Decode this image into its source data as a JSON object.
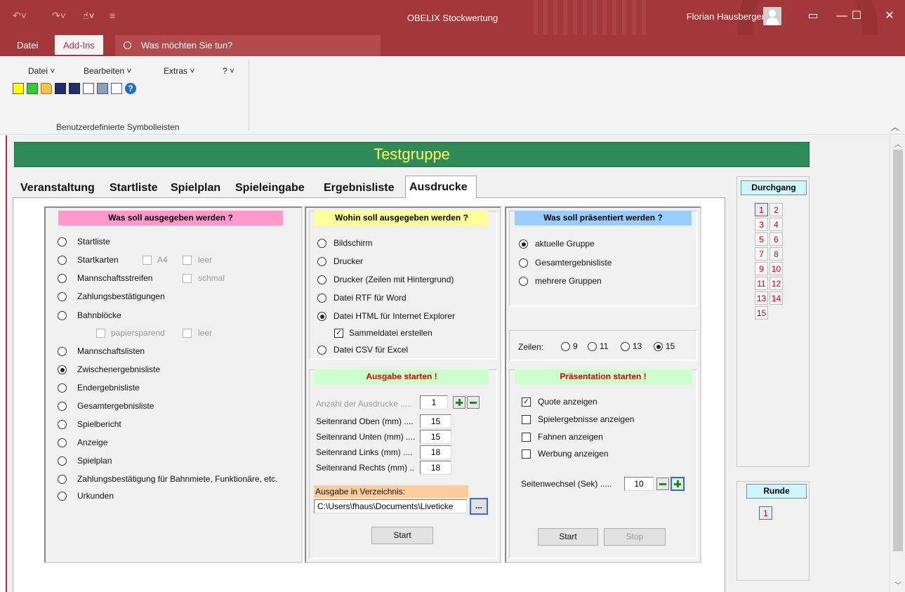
{
  "titlebar": {
    "title": "OBELIX Stockwertung",
    "user": "Florian Hausberger"
  },
  "ribbon_tabs": {
    "datei": "Datei",
    "addins": "Add-Ins",
    "tellme": "Was möchten Sie tun?"
  },
  "ribbon": {
    "menus": [
      "Datei ˅",
      "Bearbeiten ˅",
      "Extras ˅",
      "? ˅"
    ],
    "group_label": "Benutzerdefinierte Symbolleisten"
  },
  "group_title": "Testgruppe",
  "tabs": [
    "Veranstaltung",
    "Startliste",
    "Spielplan",
    "Spieleingabe",
    "Ergebnisliste",
    "Ausdrucke"
  ],
  "colors": {
    "title_bar": "#a4373a",
    "group_bar": "#2e8b57",
    "group_text": "#ffff66"
  },
  "left_panel": {
    "header": "Was soll ausgegeben werden ?",
    "options": [
      "Startliste",
      "Startkarten",
      "Mannschaftsstreifen",
      "Zahlungsbestätigungen",
      "Bahnblöcke",
      "Mannschaftslisten",
      "Zwischenergebnisliste",
      "Endergebnisliste",
      "Gesamtergebnisliste",
      "Spielbericht",
      "Anzeige",
      "Spielplan",
      "Zahlungsbestätigung für Bahnmiete, Funktionäre, etc.",
      "Urkunden"
    ],
    "sub_a4": "A4",
    "sub_leer": "leer",
    "sub_schmal": "schmal",
    "sub_papiersparend": "papiersparend",
    "sub_leer2": "leer"
  },
  "mid_panel": {
    "header": "Wohin soll ausgegeben werden ?",
    "options": [
      "Bildschirm",
      "Drucker",
      "Drucker (Zeilen mit Hintergrund)",
      "Datei RTF für Word",
      "Datei HTML für Internet Explorer",
      "Datei CSV für Excel"
    ],
    "sammeldatei": "Sammeldatei erstellen",
    "start_header": "Ausgabe starten !",
    "anzahl_label": "Anzahl der Ausdrucke .....",
    "anzahl_value": "1",
    "margins": [
      {
        "label": "Seitenrand Oben  (mm) ....",
        "value": "15"
      },
      {
        "label": "Seitenrand Unten (mm) ....",
        "value": "15"
      },
      {
        "label": "Seitenrand Links (mm) ....",
        "value": "18"
      },
      {
        "label": "Seitenrand Rechts (mm) ..",
        "value": "18"
      }
    ],
    "dir_label": "Ausgabe in Verzeichnis:",
    "dir_value": "C:\\Users\\fhaus\\Documents\\Liveticke",
    "browse": "...",
    "start": "Start"
  },
  "right_panel": {
    "header": "Was soll präsentiert werden ?",
    "options": [
      "aktuelle Gruppe",
      "Gesamtergebnisliste",
      "mehrere Gruppen"
    ],
    "zeilen_label": "Zeilen:",
    "zeilen_options": [
      "9",
      "11",
      "13",
      "15"
    ],
    "pres_header": "Präsentation starten !",
    "checks": [
      "Quote anzeigen",
      "Spielergebnisse anzeigen",
      "Fahnen anzeigen",
      "Werbung anzeigen"
    ],
    "wechsel_label": "Seitenwechsel (Sek) .....",
    "wechsel_value": "10",
    "start": "Start",
    "stop": "Stop"
  },
  "durchgang": {
    "header": "Durchgang",
    "numbers": [
      "1",
      "2",
      "3",
      "4",
      "5",
      "6",
      "7",
      "8",
      "9",
      "10",
      "11",
      "12",
      "13",
      "14",
      "15"
    ]
  },
  "runde": {
    "header": "Runde",
    "numbers": [
      "1"
    ]
  }
}
